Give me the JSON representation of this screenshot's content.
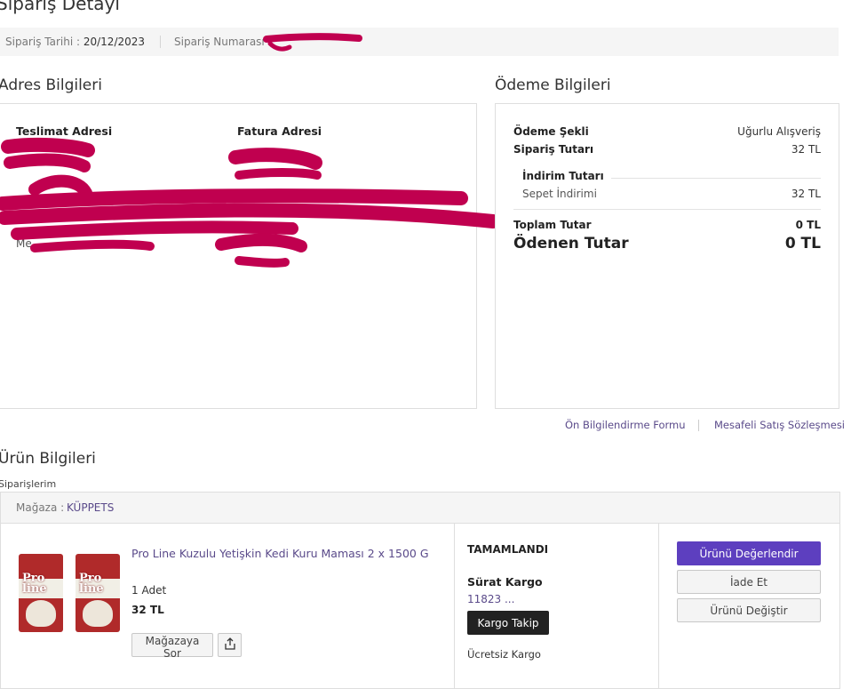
{
  "page": {
    "title": "Sipariş Detayı"
  },
  "order": {
    "date_label": "Sipariş Tarihi :",
    "date_value": "20/12/2023",
    "number_label": "Sipariş Numarası"
  },
  "address": {
    "section_title": "Adres Bilgileri",
    "delivery_title": "Teslimat Adresi",
    "invoice_title": "Fatura Adresi",
    "visible_fragment": "Me"
  },
  "payment": {
    "section_title": "Ödeme Bilgileri",
    "method_label": "Ödeme Şekli",
    "method_value": "Uğurlu Alışveriş",
    "order_total_label": "Sipariş Tutarı",
    "order_total_value": "32 TL",
    "discount_title": "İndirim Tutarı",
    "cart_discount_label": "Sepet İndirimi",
    "cart_discount_value": "32 TL",
    "grand_total_label": "Toplam Tutar",
    "grand_total_value": "0 TL",
    "paid_label": "Ödenen Tutar",
    "paid_value": "0 TL"
  },
  "links": {
    "pre_info_form": "Ön Bilgilendirme Formu",
    "distance_sales": "Mesafeli Satış Sözleşmesi"
  },
  "product_section": {
    "title": "Ürün Bilgileri",
    "breadcrumb": "Siparişlerim",
    "store_label": "Mağaza :",
    "store_name": "KÜPPETS"
  },
  "product": {
    "name": "Pro Line Kuzulu Yetişkin Kedi Kuru Maması 2 x 1500 G",
    "quantity": "1 Adet",
    "price": "32 TL",
    "pack_logo_1": "Pro",
    "pack_logo_2": "line",
    "ask_store_label": "Mağazaya Sor",
    "status": "TAMAMLANDI",
    "carrier": "Sürat Kargo",
    "tracking_number": "11823 ...",
    "track_button": "Kargo Takip",
    "shipping_note": "Ücretsiz Kargo",
    "rate_button": "Ürünü Değerlendir",
    "return_button": "İade Et",
    "exchange_button": "Ürünü Değiştir"
  },
  "colors": {
    "accent": "#5d3fbf",
    "link": "#5a4a8a",
    "redaction": "#c0004f",
    "bar_bg": "#f5f5f5",
    "border": "#dedede"
  },
  "icons": {
    "share": "share-icon"
  }
}
